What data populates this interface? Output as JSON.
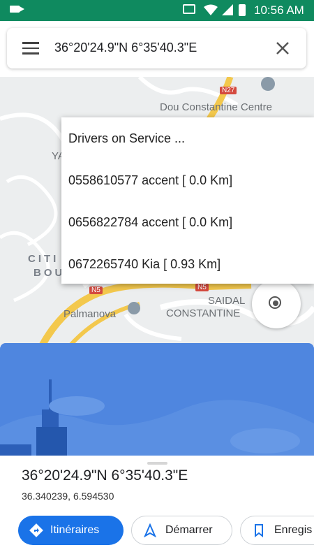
{
  "status_bar": {
    "time": "10:56 AM"
  },
  "search": {
    "query": "36°20'24.9\"N 6°35'40.3\"E"
  },
  "map": {
    "labels": {
      "dou_constantine": "Dou Constantine Centre",
      "palmanova": "Palmanova",
      "saidal": "SAIDAL",
      "constantine": "CONSTANTINE",
      "cite_partial": "CITI",
      "bou_partial": "BOU",
      "ya_partial": "YA"
    },
    "road_tags": {
      "n27": "N27",
      "n5_left": "N5",
      "n5_right": "N5"
    }
  },
  "drivers_popup": {
    "title": "Drivers on Service ...",
    "drivers": [
      "0558610577 accent [ 0.0 Km]",
      "0656822784 accent [ 0.0 Km]",
      "0672265740 Kia [ 0.93 Km]"
    ]
  },
  "place": {
    "coordinates_dms": "36°20'24.9\"N 6°35'40.3\"E",
    "coordinates_decimal": "36.340239, 6.594530"
  },
  "actions": {
    "directions": "Itinéraires",
    "start": "Démarrer",
    "save": "Enregis"
  },
  "colors": {
    "status_bar": "#0f8a5f",
    "accent": "#1a73e8",
    "illustration": "#4f86df"
  }
}
